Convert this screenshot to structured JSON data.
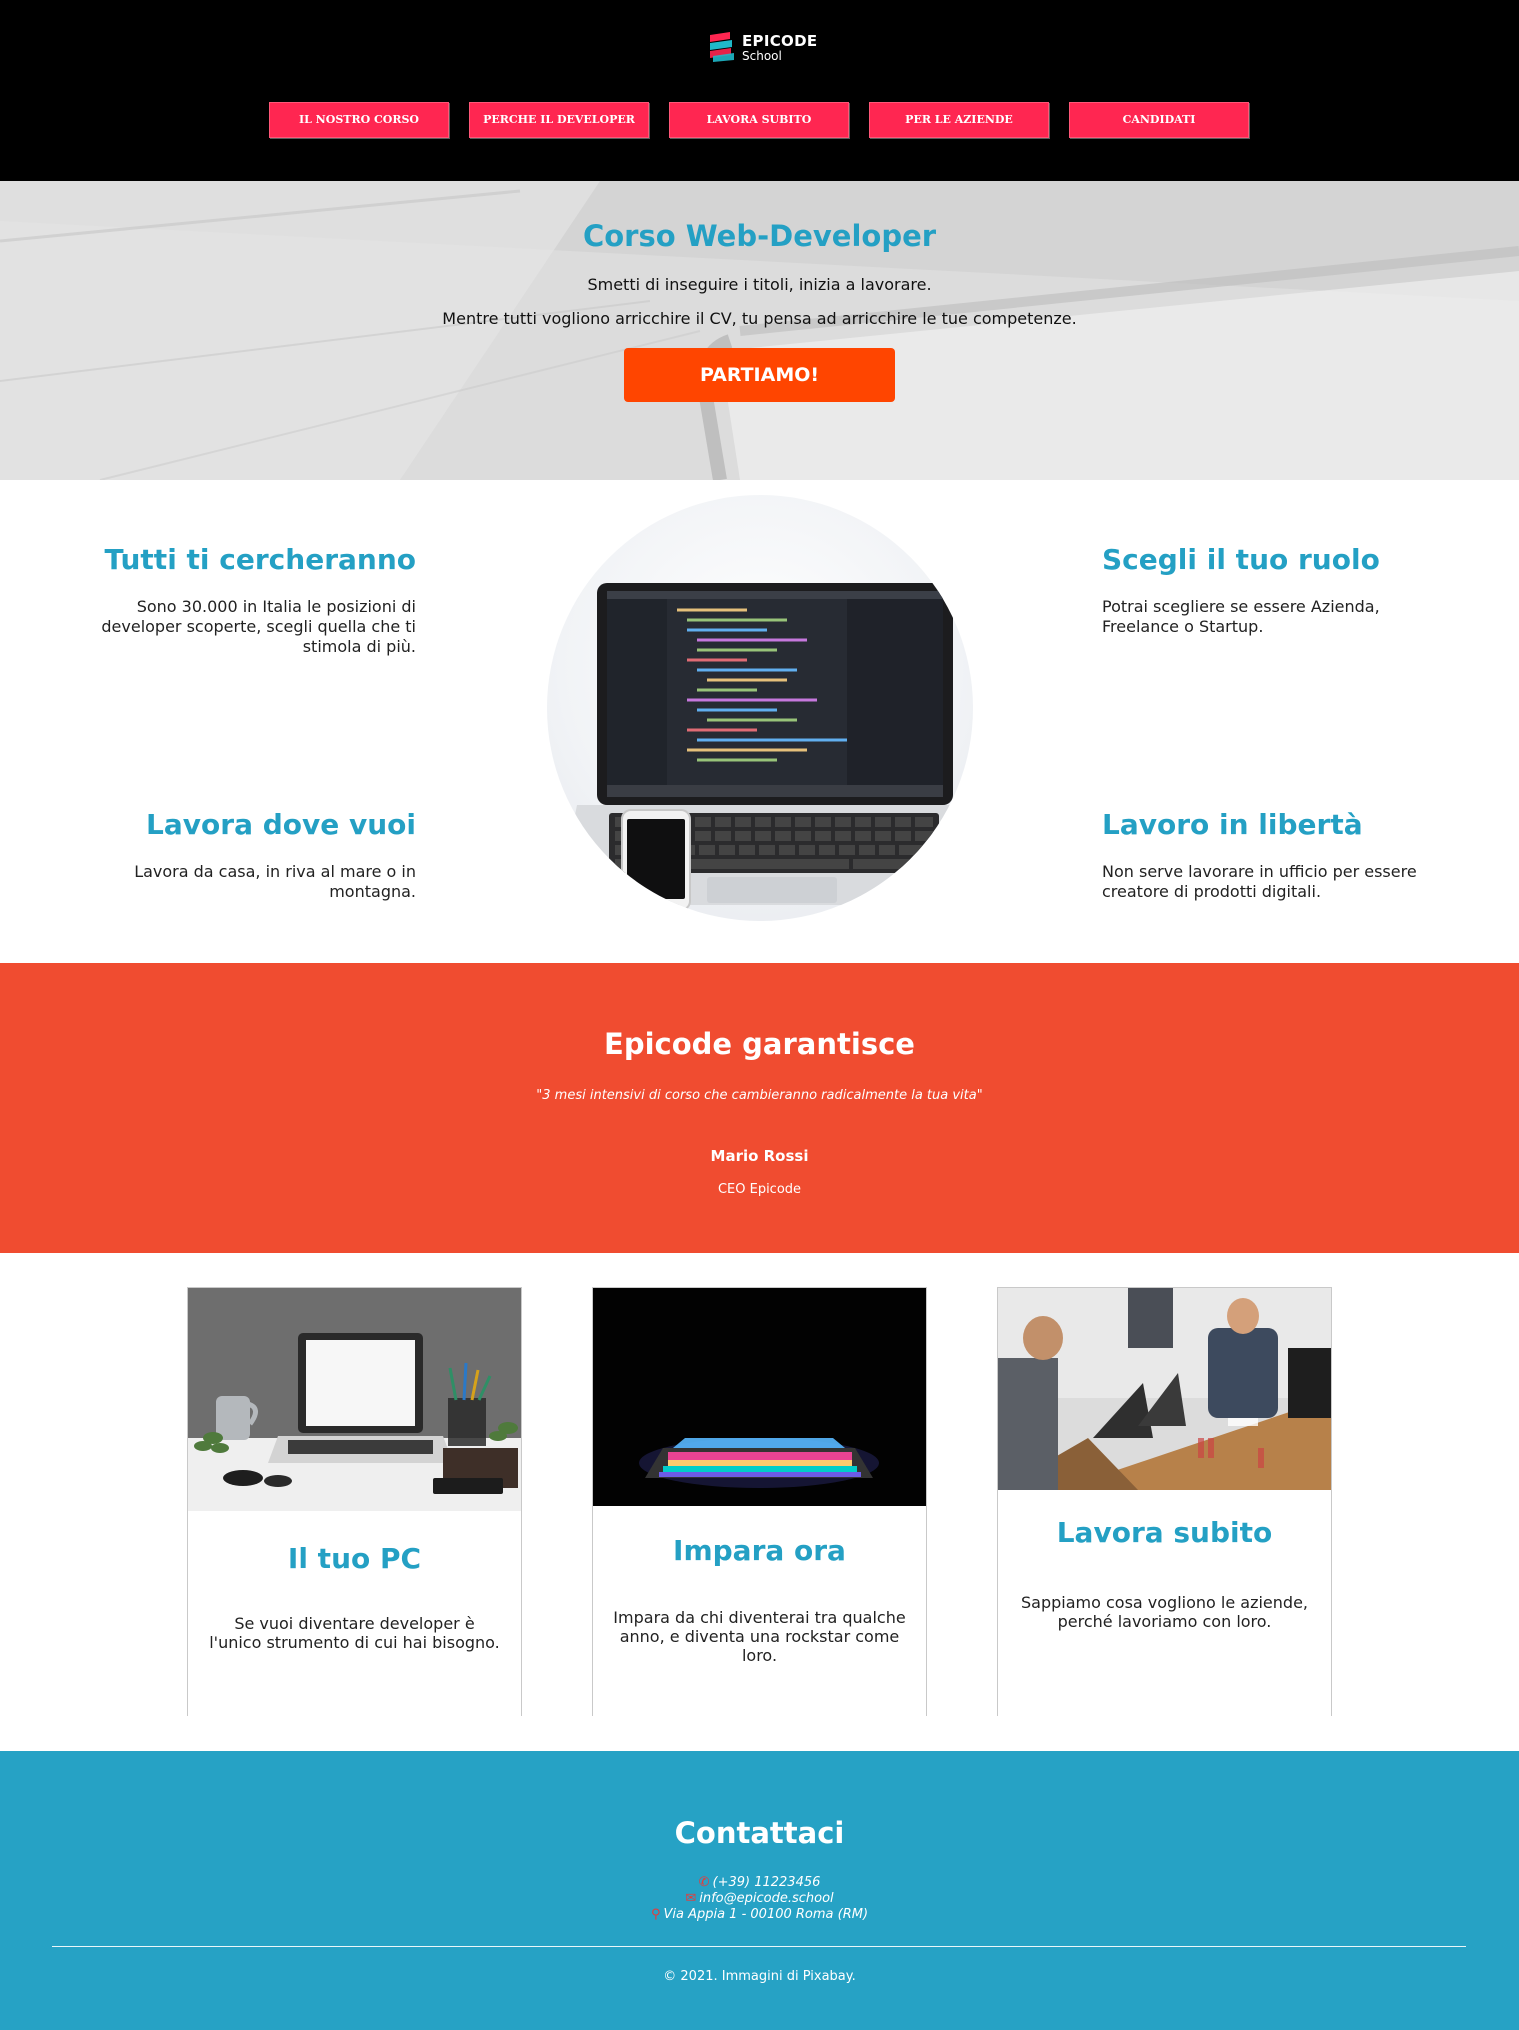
{
  "brand": {
    "name": "EPICODE",
    "sub": "School"
  },
  "nav": {
    "items": [
      {
        "label": "IL NOSTRO CORSO"
      },
      {
        "label": "PERCHE IL DEVELOPER"
      },
      {
        "label": "LAVORA SUBITO"
      },
      {
        "label": "PER LE AZIENDE"
      },
      {
        "label": "CANDIDATI"
      }
    ]
  },
  "hero": {
    "title": "Corso Web-Developer",
    "line1": "Smetti di inseguire i titoli, inizia a lavorare.",
    "line2": "Mentre tutti vogliono arricchire il CV, tu pensa ad arricchire le tue competenze.",
    "cta": "PARTIAMO!"
  },
  "features": {
    "top_left": {
      "title": "Tutti ti cercheranno",
      "text": "Sono 30.000 in Italia le posizioni di developer scoperte, scegli quella che ti stimola di più."
    },
    "bottom_left": {
      "title": "Lavora dove vuoi",
      "text": "Lavora da casa, in riva al mare o in montagna."
    },
    "top_right": {
      "title": "Scegli il tuo ruolo",
      "text": "Potrai scegliere se essere Azienda, Freelance o Startup."
    },
    "bottom_right": {
      "title": "Lavoro in libertà",
      "text": "Non serve lavorare in ufficio per essere creatore di prodotti digitali."
    }
  },
  "quote": {
    "title": "Epicode garantisce",
    "text": "\"3 mesi intensivi di corso che cambieranno radicalmente la tua vita\"",
    "author": "Mario Rossi",
    "role": "CEO Epicode"
  },
  "cards": [
    {
      "title": "Il tuo PC",
      "text": "Se vuoi diventare developer è l'unico strumento di cui hai bisogno."
    },
    {
      "title": "Impara ora",
      "text": "Impara da chi diventerai tra qualche anno, e diventa una rockstar come loro."
    },
    {
      "title": "Lavora subito",
      "text": "Sappiamo cosa vogliono le aziende, perché lavoriamo con loro."
    }
  ],
  "footer": {
    "title": "Contattaci",
    "phone": "(+39) 11223456",
    "email": "info@epicode.school",
    "address": "Via Appia 1 - 00100 Roma (RM)",
    "copyright": "© 2021. Immagini di Pixabay."
  },
  "colors": {
    "accent_blue": "#24a0c4",
    "nav_pink": "#ff2651",
    "cta_orange": "#ff4500",
    "quote_red": "#f04c30",
    "footer_blue": "#26a2c5"
  },
  "icons": {
    "phone": "phone-icon",
    "email": "envelope-icon",
    "address": "map-pin-icon"
  }
}
